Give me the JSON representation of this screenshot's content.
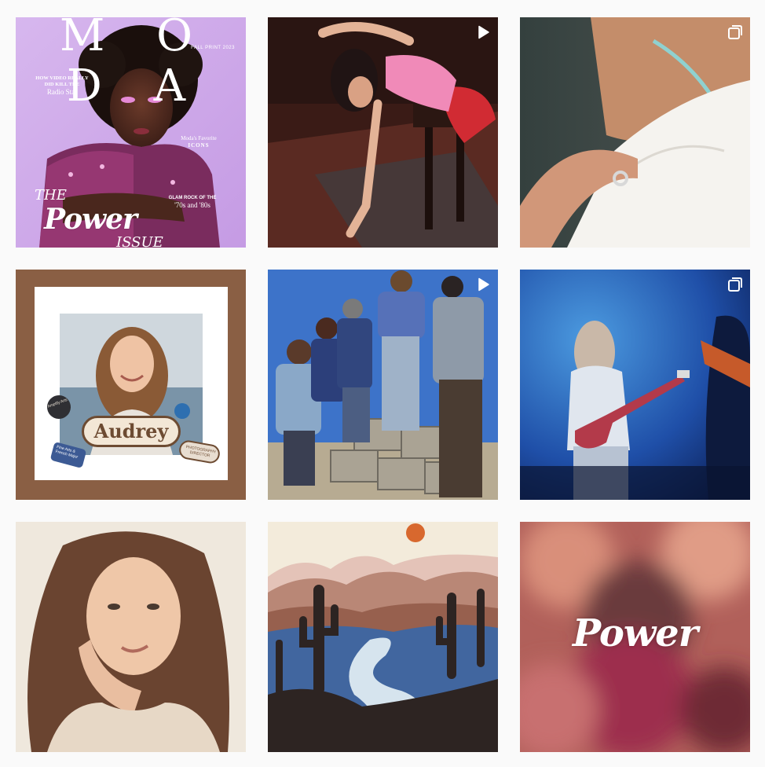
{
  "grid": {
    "posts": [
      {
        "id_label": "moda-cover",
        "type": "image",
        "cover": {
          "brand": "M O D A",
          "edition": "FALL PRINT 2023",
          "headline_line1": "HOW VIDEO REALLY",
          "headline_line2": "DID KILL THE",
          "headline_line3": "Radio Star",
          "icons_line1": "Moda's Favorite",
          "icons_line2": "ICONS",
          "glam_line1": "GLAM ROCK OF THE",
          "glam_line2": "'70s and '80s",
          "the_word": "THE",
          "power_word": "Power",
          "issue_word": "ISSUE"
        }
      },
      {
        "id_label": "dancer-photo",
        "type": "reel"
      },
      {
        "id_label": "shirt-closeup",
        "type": "carousel"
      },
      {
        "id_label": "audrey-card",
        "type": "image",
        "card": {
          "name": "Audrey",
          "sticker_left": "Amplify Arts",
          "sticker_blue": "Fine Arts & French Major",
          "sticker_right": "PHOTOGRAPHY DIRECTOR"
        }
      },
      {
        "id_label": "band-group",
        "type": "reel"
      },
      {
        "id_label": "guitarist-stage",
        "type": "carousel"
      },
      {
        "id_label": "portrait-woman",
        "type": "image"
      },
      {
        "id_label": "desert-illustration",
        "type": "image"
      },
      {
        "id_label": "power-blur",
        "type": "image",
        "overlay_text": "Power"
      }
    ]
  },
  "colors": {
    "page_background": "#fafafa",
    "audrey_frame": "#8a5f44",
    "badge_icon": "#ffffff"
  },
  "icons": {
    "reel": "play-icon",
    "carousel": "carousel-icon"
  }
}
